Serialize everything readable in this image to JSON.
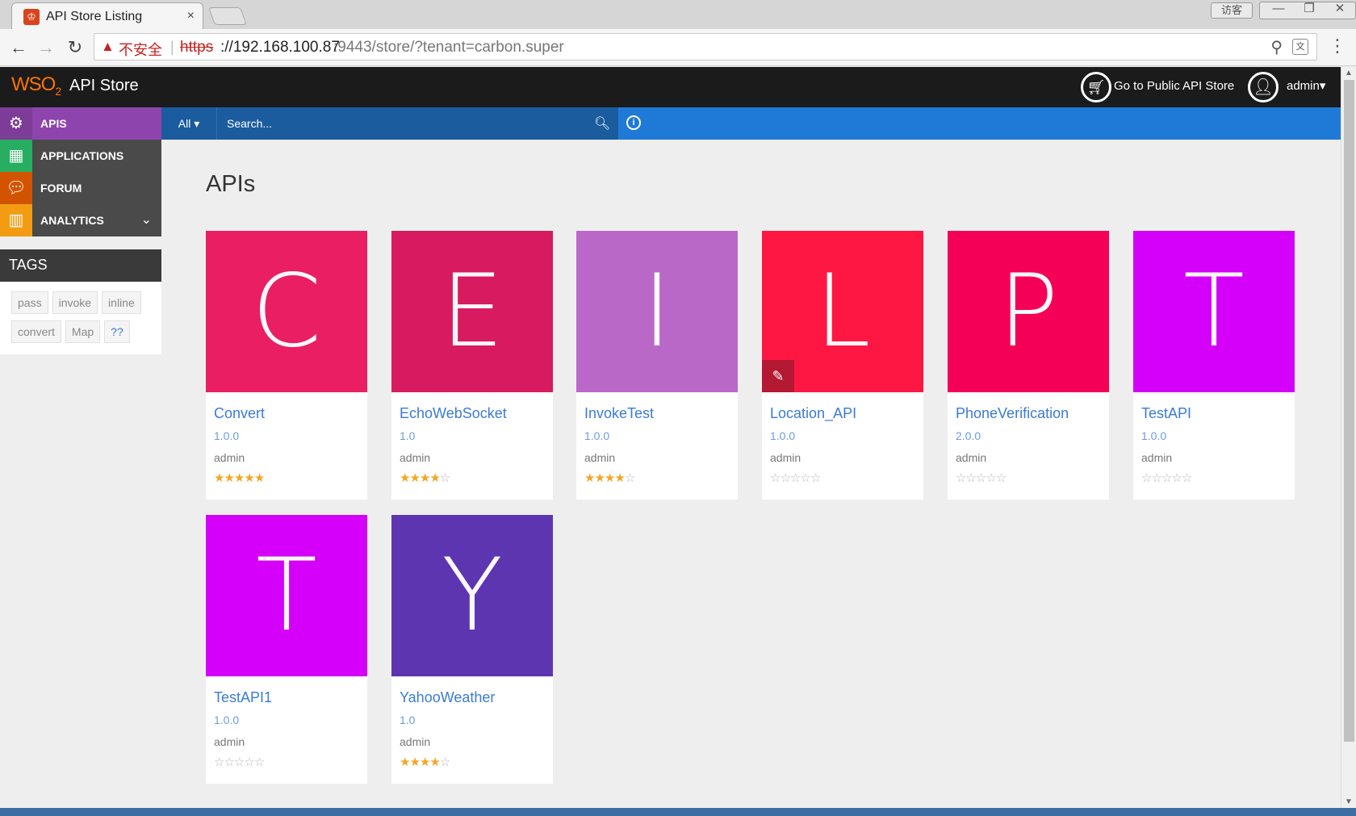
{
  "browser": {
    "tab_title": "API Store Listing",
    "tab_close": "×",
    "guest_label": "访客",
    "security_label": "不安全",
    "url_scheme": "https",
    "url_host": "://192.168.100.87",
    "url_rest": ":9443/store/?tenant=carbon.super"
  },
  "header": {
    "logo": "WSO",
    "logo_sub": "2",
    "app_title": "API Store",
    "public_store_label": "Go to Public API Store",
    "user_label": "admin▾"
  },
  "sidebar": {
    "items": [
      {
        "label": "APIS",
        "color": "#8e44ad",
        "icon_color": "#7d3c98"
      },
      {
        "label": "APPLICATIONS",
        "color": "#4a4a4a",
        "icon_color": "#27ae60"
      },
      {
        "label": "FORUM",
        "color": "#4a4a4a",
        "icon_color": "#d35400"
      },
      {
        "label": "ANALYTICS",
        "color": "#4a4a4a",
        "icon_color": "#f39c12"
      }
    ],
    "tags_title": "TAGS",
    "tags": [
      "pass",
      "invoke",
      "inline",
      "convert",
      "Map",
      "??"
    ]
  },
  "search": {
    "scope": "All ▾",
    "placeholder": "Search..."
  },
  "main": {
    "title": "APIs",
    "apis": [
      {
        "letter": "C",
        "name": "Convert",
        "version": "1.0.0",
        "provider": "admin",
        "rating": 5,
        "color": "#e91e63"
      },
      {
        "letter": "E",
        "name": "EchoWebSocket",
        "version": "1.0",
        "provider": "admin",
        "rating": 4,
        "color": "#d81b60"
      },
      {
        "letter": "I",
        "name": "InvokeTest",
        "version": "1.0.0",
        "provider": "admin",
        "rating": 4,
        "color": "#ba68c8"
      },
      {
        "letter": "L",
        "name": "Location_API",
        "version": "1.0.0",
        "provider": "admin",
        "rating": 0,
        "color": "#ff1744",
        "editable": true
      },
      {
        "letter": "P",
        "name": "PhoneVerification",
        "version": "2.0.0",
        "provider": "admin",
        "rating": 0,
        "color": "#f50057"
      },
      {
        "letter": "T",
        "name": "TestAPI",
        "version": "1.0.0",
        "provider": "admin",
        "rating": 0,
        "color": "#d500f9"
      },
      {
        "letter": "T",
        "name": "TestAPI1",
        "version": "1.0.0",
        "provider": "admin",
        "rating": 0,
        "color": "#d500f9"
      },
      {
        "letter": "Y",
        "name": "YahooWeather",
        "version": "1.0",
        "provider": "admin",
        "rating": 4,
        "color": "#5e35b1"
      }
    ]
  }
}
